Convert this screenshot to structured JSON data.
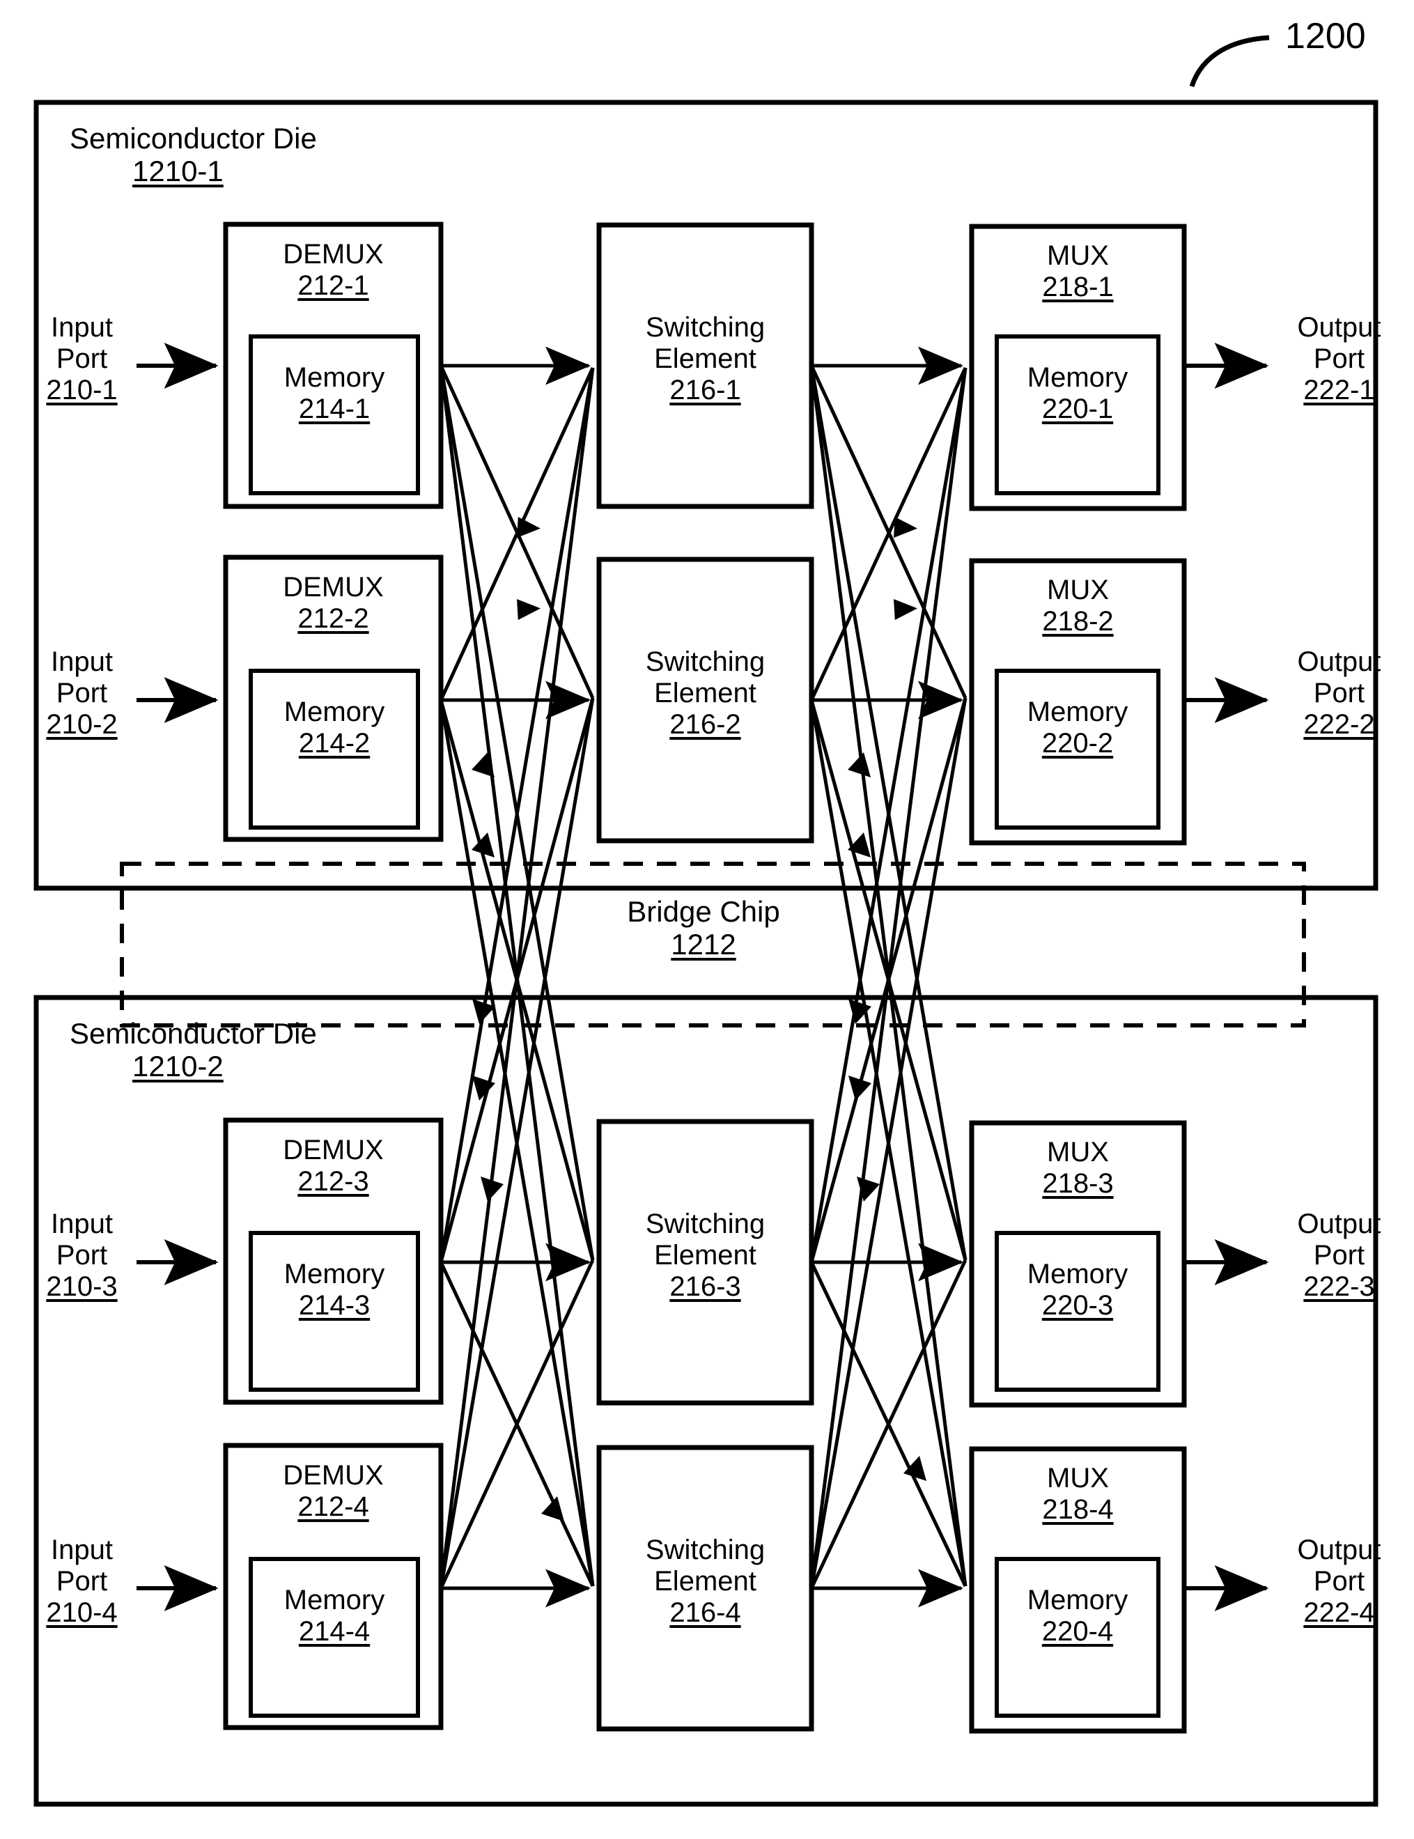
{
  "figure": {
    "number": "1200",
    "leader_icon": "curved-leader-line"
  },
  "dies": [
    {
      "id": "die-1",
      "title": "Semiconductor Die",
      "ref": "1210-1"
    },
    {
      "id": "die-2",
      "title": "Semiconductor Die",
      "ref": "1210-2"
    }
  ],
  "bridge": {
    "title": "Bridge Chip",
    "ref": "1212"
  },
  "rows": [
    {
      "input_port": {
        "line1": "Input",
        "line2": "Port",
        "ref": "210-1"
      },
      "demux": {
        "title": "DEMUX",
        "ref": "212-1"
      },
      "demux_memory": {
        "title": "Memory",
        "ref": "214-1"
      },
      "switching": {
        "line1": "Switching",
        "line2": "Element",
        "ref": "216-1"
      },
      "mux": {
        "title": "MUX",
        "ref": "218-1"
      },
      "mux_memory": {
        "title": "Memory",
        "ref": "220-1"
      },
      "output_port": {
        "line1": "Output",
        "line2": "Port",
        "ref": "222-1"
      }
    },
    {
      "input_port": {
        "line1": "Input",
        "line2": "Port",
        "ref": "210-2"
      },
      "demux": {
        "title": "DEMUX",
        "ref": "212-2"
      },
      "demux_memory": {
        "title": "Memory",
        "ref": "214-2"
      },
      "switching": {
        "line1": "Switching",
        "line2": "Element",
        "ref": "216-2"
      },
      "mux": {
        "title": "MUX",
        "ref": "218-2"
      },
      "mux_memory": {
        "title": "Memory",
        "ref": "220-2"
      },
      "output_port": {
        "line1": "Output",
        "line2": "Port",
        "ref": "222-2"
      }
    },
    {
      "input_port": {
        "line1": "Input",
        "line2": "Port",
        "ref": "210-3"
      },
      "demux": {
        "title": "DEMUX",
        "ref": "212-3"
      },
      "demux_memory": {
        "title": "Memory",
        "ref": "214-3"
      },
      "switching": {
        "line1": "Switching",
        "line2": "Element",
        "ref": "216-3"
      },
      "mux": {
        "title": "MUX",
        "ref": "218-3"
      },
      "mux_memory": {
        "title": "Memory",
        "ref": "220-3"
      },
      "output_port": {
        "line1": "Output",
        "line2": "Port",
        "ref": "222-3"
      }
    },
    {
      "input_port": {
        "line1": "Input",
        "line2": "Port",
        "ref": "210-4"
      },
      "demux": {
        "title": "DEMUX",
        "ref": "212-4"
      },
      "demux_memory": {
        "title": "Memory",
        "ref": "214-4"
      },
      "switching": {
        "line1": "Switching",
        "line2": "Element",
        "ref": "216-4"
      },
      "mux": {
        "title": "MUX",
        "ref": "218-4"
      },
      "mux_memory": {
        "title": "Memory",
        "ref": "220-4"
      },
      "output_port": {
        "line1": "Output",
        "line2": "Port",
        "ref": "222-4"
      }
    }
  ],
  "style": {
    "ink": "#000000",
    "paper": "#ffffff"
  }
}
